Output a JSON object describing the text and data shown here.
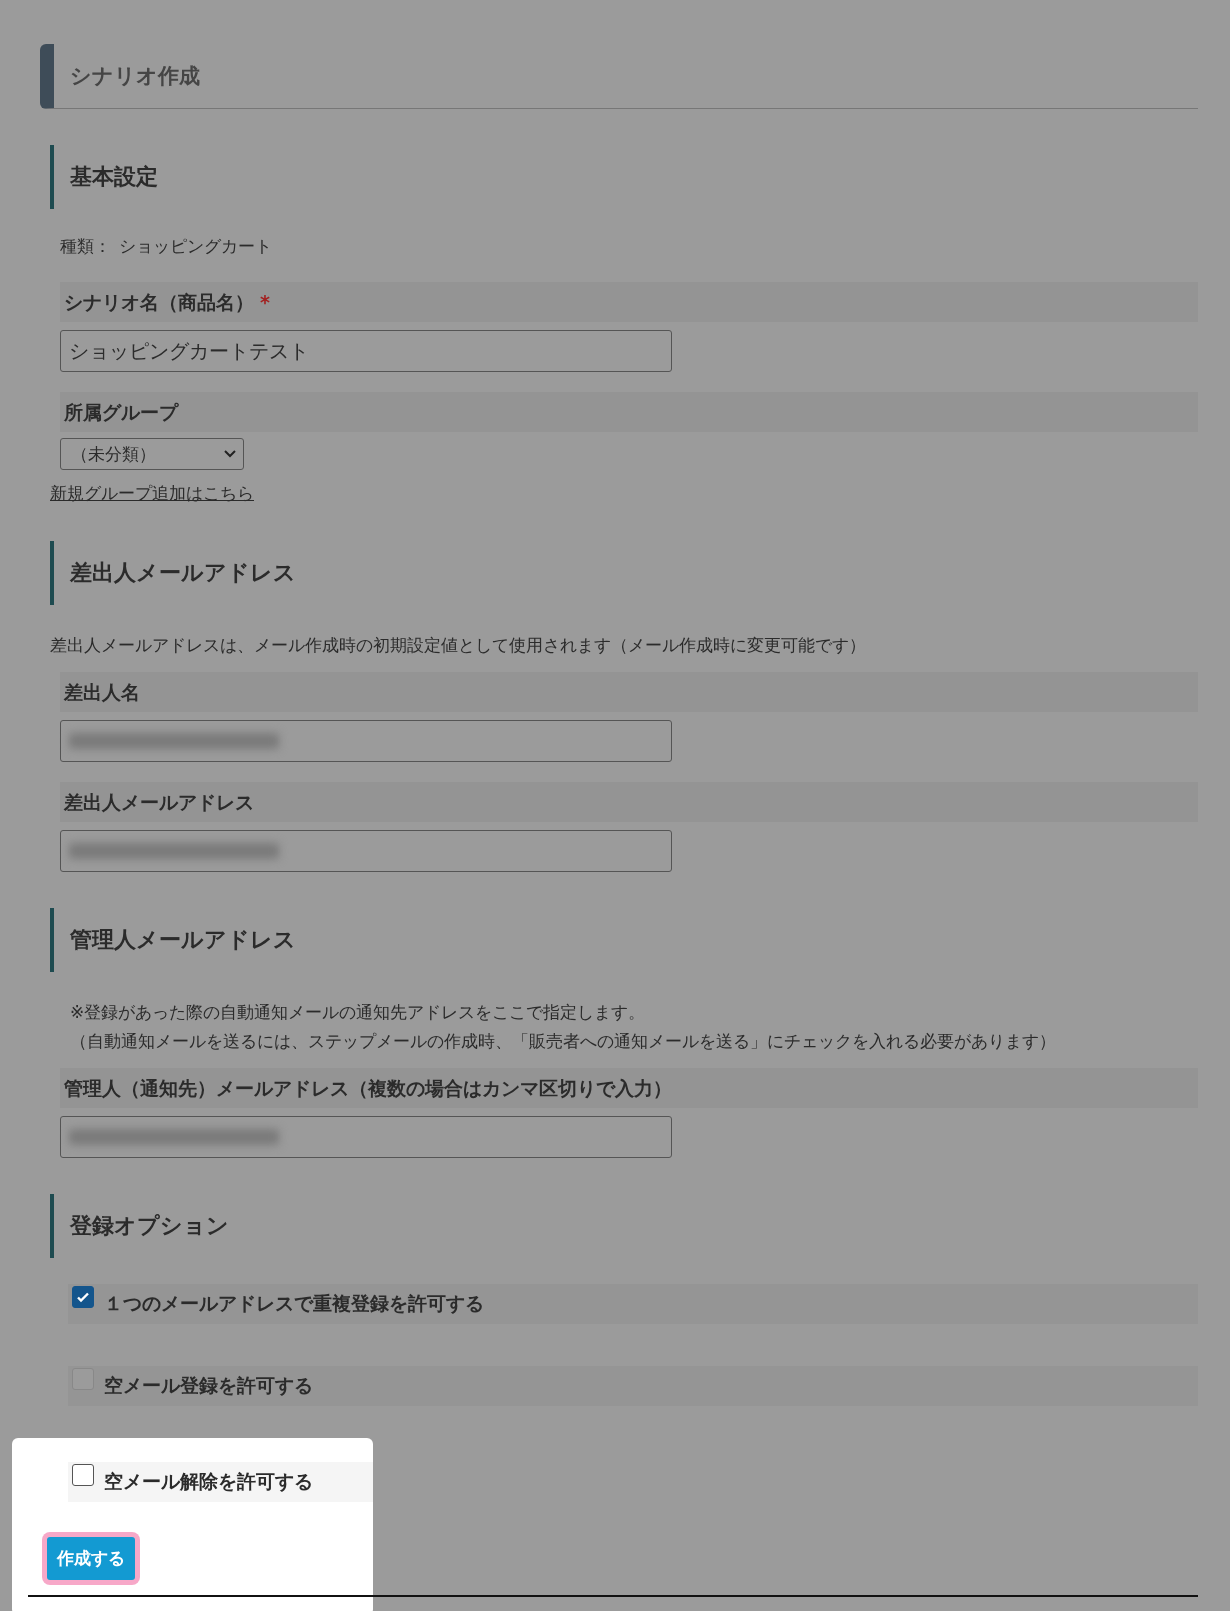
{
  "page_title": "シナリオ作成",
  "sections": [
    {
      "title": "基本設定",
      "items": [
        {
          "kind": "info",
          "label": "種類：",
          "value": "ショッピングカート"
        },
        {
          "kind": "field",
          "label": "シナリオ名（商品名）",
          "required_mark": "*",
          "value": "ショッピングカートテスト"
        },
        {
          "kind": "select",
          "label": "所属グループ",
          "value": "（未分類）"
        },
        {
          "kind": "link",
          "text": "新規グループ追加はこちら"
        }
      ]
    },
    {
      "title": "差出人メールアドレス",
      "items": [
        {
          "kind": "note",
          "lines": [
            "差出人メールアドレスは、メール作成時の初期設定値として使用されます（メール作成時に変更可能です）"
          ]
        },
        {
          "kind": "field",
          "label": "差出人名",
          "redacted": true
        },
        {
          "kind": "field",
          "label": "差出人メールアドレス",
          "redacted": true
        }
      ]
    },
    {
      "title": "管理人メールアドレス",
      "items": [
        {
          "kind": "note",
          "lines": [
            "※登録があった際の自動通知メールの通知先アドレスをここで指定します。",
            "（自動通知メールを送るには、ステップメールの作成時、「販売者への通知メールを送る」にチェックを入れる必要があります）"
          ]
        },
        {
          "kind": "field",
          "label": "管理人（通知先）メールアドレス（複数の場合はカンマ区切りで入力）",
          "redacted": true
        }
      ]
    },
    {
      "title": "登録オプション",
      "items": [
        {
          "kind": "checkbox",
          "label": "１つのメールアドレスで重複登録を許可する",
          "checked": true,
          "spotlit": false
        },
        {
          "kind": "checkbox",
          "label": "空メール登録を許可する",
          "checked": false,
          "spotlit": false
        },
        {
          "kind": "checkbox",
          "label": "空メール解除を許可する",
          "checked": false,
          "spotlit": true
        }
      ]
    }
  ],
  "submit": {
    "label": "作成する",
    "highlighted": true
  }
}
